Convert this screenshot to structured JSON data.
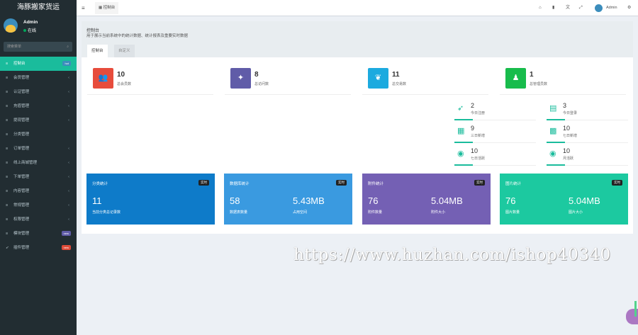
{
  "app": {
    "title": "海豚搬家货运"
  },
  "user": {
    "name": "Admin",
    "status": "在线"
  },
  "search": {
    "placeholder": "搜索菜单"
  },
  "menu": [
    {
      "label": "控制台",
      "badge": "hot",
      "badge_color": "#3c8dbc"
    },
    {
      "label": "会员管理"
    },
    {
      "label": "认证管理"
    },
    {
      "label": "充值管理"
    },
    {
      "label": "提现管理"
    },
    {
      "label": "分类管理"
    },
    {
      "label": "订单管理"
    },
    {
      "label": "线上商城管理"
    },
    {
      "label": "下单管理"
    },
    {
      "label": "内容管理"
    },
    {
      "label": "常规管理"
    },
    {
      "label": "权限管理"
    },
    {
      "label": "模块管理",
      "badge": "new",
      "badge_color": "#605ca8"
    },
    {
      "label": "插件管理",
      "badge": "new",
      "badge_color": "#dd4b39"
    }
  ],
  "topbar": {
    "tab": "控制台",
    "user": "Admin"
  },
  "panel": {
    "title": "控制台",
    "desc": "用于展示当前系统中的统计数据、统计报表及重要实时数据",
    "tabs": [
      "控制台",
      "自定义"
    ]
  },
  "stats": [
    {
      "value": "10",
      "label": "总会员数",
      "color": "#e74c3c",
      "icon": "users-icon"
    },
    {
      "value": "8",
      "label": "总访问数",
      "color": "#605ca8",
      "icon": "magic-icon"
    },
    {
      "value": "11",
      "label": "总交易数",
      "color": "#1caadf",
      "icon": "leaf-icon"
    },
    {
      "value": "1",
      "label": "总管理员数",
      "color": "#18bc4c",
      "icon": "user-icon"
    }
  ],
  "mini": [
    {
      "value": "2",
      "label": "今日注册",
      "icon": "rocket-icon"
    },
    {
      "value": "3",
      "label": "今日登录",
      "icon": "vcard-icon"
    },
    {
      "value": "9",
      "label": "三日新增",
      "icon": "calendar-icon"
    },
    {
      "value": "10",
      "label": "七日新增",
      "icon": "calendar-plus-icon"
    },
    {
      "value": "10",
      "label": "七日活跃",
      "icon": "user-circle-icon"
    },
    {
      "value": "10",
      "label": "月活跃",
      "icon": "user-circle-icon"
    }
  ],
  "cards": [
    {
      "title": "分类统计",
      "badge": "实时",
      "v1": "11",
      "l1": "当前分类总记录数",
      "v2": "",
      "l2": "",
      "bg": "#0e7bc9"
    },
    {
      "title": "数据库统计",
      "badge": "实时",
      "v1": "58",
      "l1": "数据表数量",
      "v2": "5.43MB",
      "l2": "占用空间",
      "bg": "#3a9ae0"
    },
    {
      "title": "附件统计",
      "badge": "实时",
      "v1": "76",
      "l1": "附件数量",
      "v2": "5.04MB",
      "l2": "附件大小",
      "bg": "#7460b4"
    },
    {
      "title": "图片统计",
      "badge": "实时",
      "v1": "76",
      "l1": "图片数量",
      "v2": "5.04MB",
      "l2": "图片大小",
      "bg": "#1cc9a0"
    }
  ],
  "watermark": "https://www.huzhan.com/ishop40340"
}
